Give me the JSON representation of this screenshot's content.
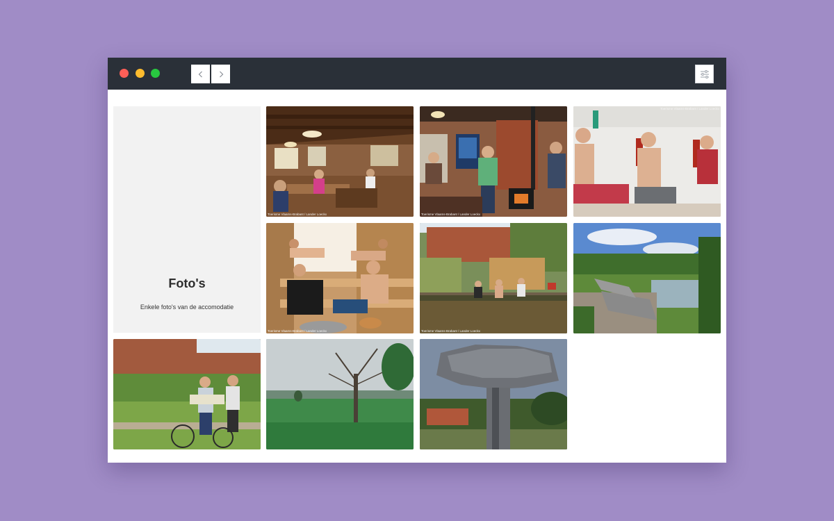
{
  "window": {
    "colors": {
      "titlebar": "#2a3038",
      "desktop": "#a08cc6",
      "close": "#ff5f57",
      "minimize": "#febc2e",
      "zoom": "#28c840"
    },
    "icons": {
      "back": "chevron-left-icon",
      "forward": "chevron-right-icon",
      "menu": "sliders-icon"
    }
  },
  "gallery": {
    "title": "Foto's",
    "subtitle": "Enkele foto's van de accomodatie",
    "credits": {
      "dining": "Toerisme Vlaams-Brabant / Lander Loeckx",
      "lounge": "Toerisme Vlaams-Brabant / Lander Loeckx",
      "sauna_bench": "Toerisme Vlaams-Brabant / Lander Loeckx",
      "sauna_interior": "Toerisme Vlaams-Brabant / Lander Loeckx",
      "pond": "Toerisme Vlaams-Brabant / Lander Loeckx"
    }
  }
}
